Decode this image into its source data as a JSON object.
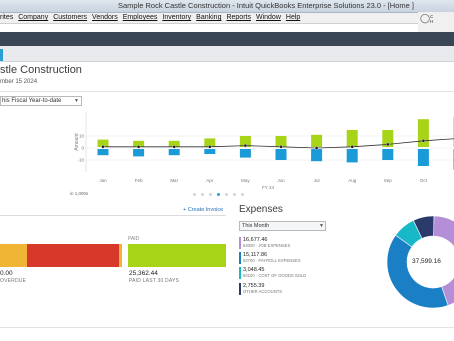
{
  "window": {
    "title": "Sample Rock Castle Construction  - Intuit QuickBooks Enterprise Solutions 23.0 - [Home ]"
  },
  "menu": [
    "rites",
    "Company",
    "Customers",
    "Vendors",
    "Employees",
    "Inventory",
    "Banking",
    "Reports",
    "Window",
    "Help"
  ],
  "help_icon": {
    "name": "lightbulb-icon",
    "line1": "C",
    "line2": "H"
  },
  "company": {
    "name": "stle Construction",
    "date": "mber 15 2024"
  },
  "period_select": {
    "value": "his Fiscal Year-to-date"
  },
  "chart_data": {
    "type": "bar",
    "categories": [
      "Jan",
      "Feb",
      "Mar",
      "Apr",
      "May",
      "Jun",
      "Jul",
      "Aug",
      "Sep",
      "Oct"
    ],
    "xlabel": "FY 24",
    "ylabel": "Amount",
    "units": "in 1,000s",
    "yticks": [
      "10",
      "0",
      "-10"
    ],
    "ylim": [
      -20,
      30
    ],
    "series": [
      {
        "values": [
          7,
          6,
          6,
          8,
          10,
          10,
          11,
          15,
          15,
          24,
          26
        ]
      },
      {
        "values": [
          -6,
          -7,
          -6,
          -5,
          -8,
          -10,
          -11,
          -12,
          -10,
          -15,
          -18
        ]
      },
      {
        "values": [
          1,
          1,
          1,
          1,
          2,
          1,
          0,
          1,
          3,
          6,
          8
        ]
      }
    ],
    "colors": {
      "income": "#a8d418",
      "expense": "#1a9ad6",
      "net": "#333333"
    }
  },
  "carousel": {
    "dots": 7,
    "active": 3
  },
  "invoices": {
    "create_link": "+ Create Invoice",
    "paid_label": "PAID",
    "overdue_amount": "0.00",
    "overdue_label": "OVERDUE",
    "paid_amount": "25,362.44",
    "paid_sub": "PAID LAST 30 DAYS",
    "bar_colors": {
      "open": "#f0b534",
      "overdue": "#d8382a",
      "paid": "#a8d418"
    }
  },
  "expenses": {
    "title": "Expenses",
    "period": "This Month",
    "total": "37,599.16",
    "items": [
      {
        "amount": "16,677.46",
        "label": "54000 · JOB EXPENSES",
        "color": "#b48fd8",
        "share": 0.4436
      },
      {
        "amount": "15,117.86",
        "label": "62700 · PAYROLL EXPENSES",
        "color": "#1a7fc4",
        "share": 0.4021
      },
      {
        "amount": "3,048.45",
        "label": "50100 · COST OF GOODS SOLD",
        "color": "#18b8c8",
        "share": 0.0811
      },
      {
        "amount": "2,755.39",
        "label": "OTHER ACCOUNTS",
        "color": "#2a3a6a",
        "share": 0.0733
      }
    ]
  }
}
